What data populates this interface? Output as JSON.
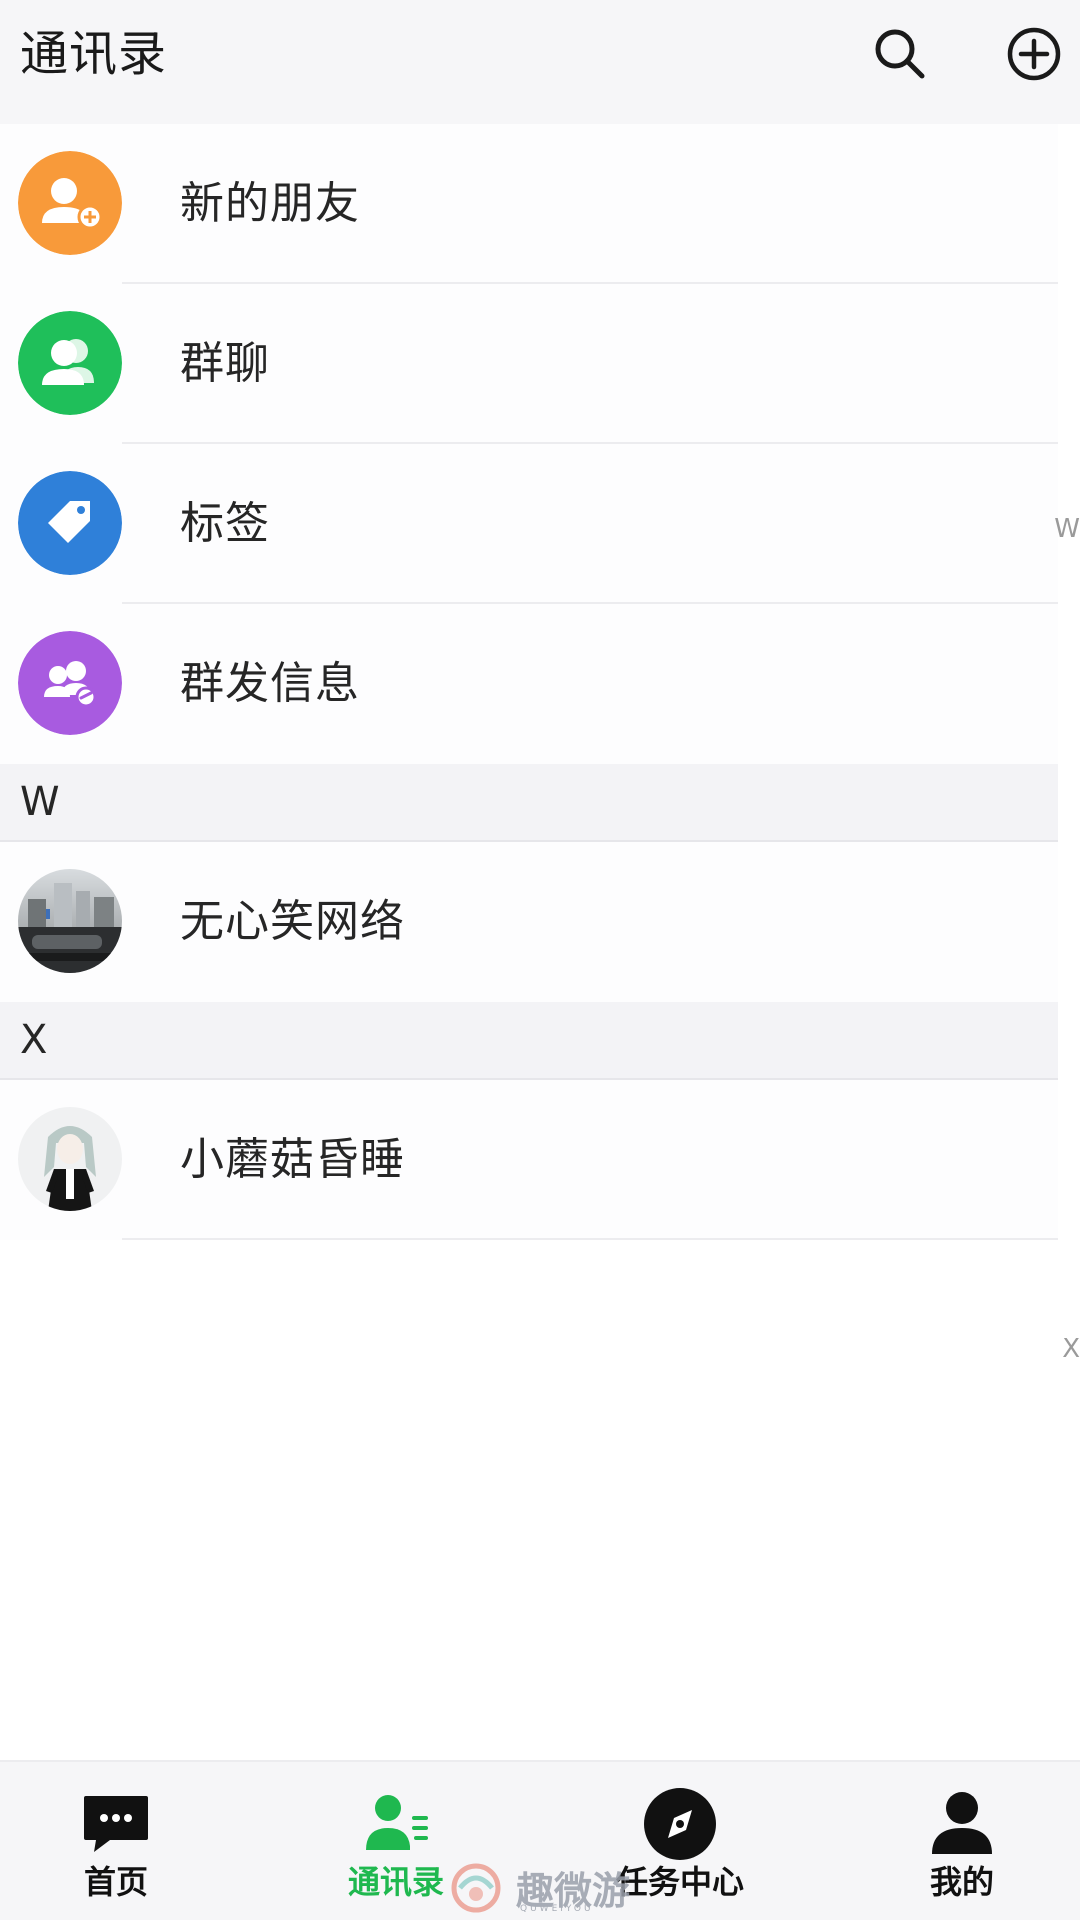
{
  "header": {
    "title": "通讯录",
    "search_icon": "search-icon",
    "add_icon": "plus-circle-icon"
  },
  "functions": [
    {
      "label": "新的朋友",
      "icon": "add-friend-icon",
      "color": "#f89a3a"
    },
    {
      "label": "群聊",
      "icon": "group-chat-icon",
      "color": "#1fbf5a"
    },
    {
      "label": "标签",
      "icon": "tag-icon",
      "color": "#2f80d9"
    },
    {
      "label": "群发信息",
      "icon": "broadcast-icon",
      "color": "#a85be0"
    }
  ],
  "sections": [
    {
      "letter": "W",
      "contacts": [
        {
          "name": "无心笑网络",
          "avatar": "photo-avatar"
        }
      ]
    },
    {
      "letter": "X",
      "contacts": [
        {
          "name": "小蘑菇昏睡",
          "avatar": "anime-avatar"
        }
      ]
    }
  ],
  "index_hints": [
    "W",
    "X"
  ],
  "bottom_nav": [
    {
      "label": "首页",
      "icon": "chat-bubble-icon",
      "active": false
    },
    {
      "label": "通讯录",
      "icon": "contacts-icon",
      "active": true
    },
    {
      "label": "任务中心",
      "icon": "compass-icon",
      "active": false
    },
    {
      "label": "我的",
      "icon": "user-icon",
      "active": false
    }
  ],
  "colors": {
    "accent": "#1fb84f",
    "header_bg": "#f6f6f8",
    "section_bg": "#f3f3f6"
  },
  "watermark": {
    "text": "趣微游",
    "sub": "QUWEIYOU"
  }
}
